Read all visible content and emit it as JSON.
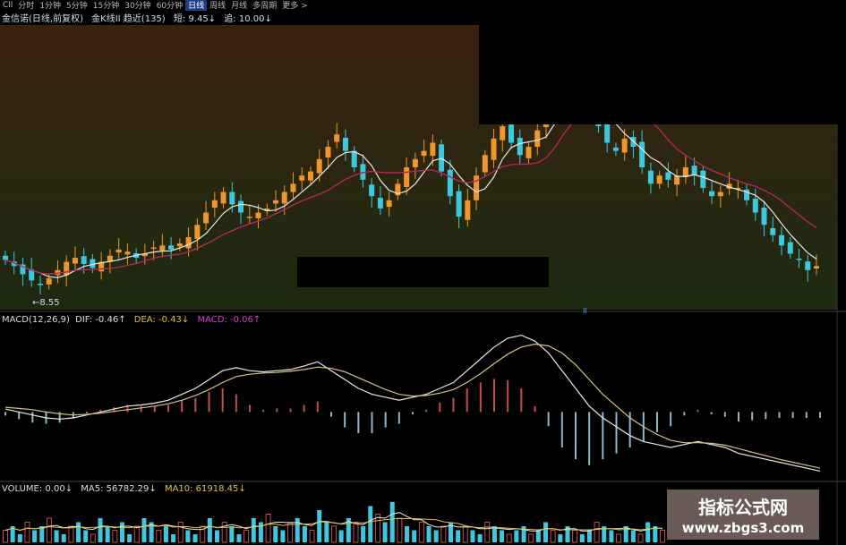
{
  "toolbar": {
    "items": [
      "Cll",
      "分时",
      "1分钟",
      "5分钟",
      "15分钟",
      "30分钟",
      "60分钟",
      "日线",
      "周线",
      "月线",
      "多周期",
      "更多 >"
    ],
    "active_index": 7
  },
  "price_panel": {
    "stock_label": "金信诺(日线,前复权)",
    "indicator_label": "金K线II 趋近(135)",
    "short_label": "短: 9.45↓",
    "up_label": "追: 10.00↓",
    "low_price_label": "8.55",
    "marker_label": "II"
  },
  "macd_panel": {
    "title": "MACD(12,26,9)",
    "dif_label": "DIF: -0.46↑",
    "dea_label": "DEA: -0.43↓",
    "macd_label": "MACD: -0.06↑"
  },
  "volume_panel": {
    "title": "VOLUME: 0.00↓",
    "ma5_label": "MA5: 56782.29↓",
    "ma10_label": "MA10: 61918.45↓"
  },
  "watermark": {
    "line1": "指标公式网",
    "line2": "www.zbgs3.com"
  },
  "colors": {
    "up": "#f0962a",
    "down": "#3ec8e0",
    "ma_short": "#e8e8e8",
    "ma_long": "#b0285a",
    "macd_up": "#c84a4a",
    "macd_down": "#8fb8c8",
    "dif": "#e8e8e8",
    "dea": "#d8c080",
    "ma10_color": "#e0c040",
    "macd_color": "#d040d0"
  },
  "chart_data": {
    "type": "candlestick",
    "close": [
      9.35,
      9.2,
      9.0,
      8.85,
      8.75,
      8.9,
      9.1,
      9.3,
      9.4,
      9.25,
      9.15,
      9.3,
      9.45,
      9.6,
      9.55,
      9.4,
      9.5,
      9.65,
      9.7,
      9.6,
      9.75,
      9.9,
      10.2,
      10.5,
      10.8,
      11.0,
      10.7,
      10.5,
      10.4,
      10.5,
      10.6,
      10.8,
      11.0,
      11.2,
      11.4,
      11.5,
      11.8,
      12.1,
      12.4,
      12.0,
      11.6,
      11.3,
      10.9,
      10.6,
      10.8,
      11.2,
      11.6,
      11.8,
      12.0,
      12.2,
      11.5,
      10.9,
      10.4,
      10.8,
      11.4,
      11.9,
      12.3,
      12.6,
      12.2,
      11.9,
      12.1,
      12.5,
      13.0,
      13.8,
      14.4,
      14.0,
      13.5,
      13.0,
      12.6,
      12.2,
      12.0,
      12.3,
      12.1,
      11.6,
      11.2,
      11.4,
      11.3,
      11.4,
      11.6,
      11.4,
      11.1,
      10.9,
      11.0,
      11.2,
      11.1,
      10.8,
      10.5,
      10.2,
      9.95,
      9.7,
      9.5,
      9.35,
      9.1,
      9.2
    ],
    "dif": [
      0.05,
      0.0,
      -0.05,
      -0.1,
      -0.12,
      -0.1,
      -0.05,
      0.0,
      0.05,
      0.1,
      0.12,
      0.15,
      0.2,
      0.3,
      0.4,
      0.55,
      0.7,
      0.75,
      0.7,
      0.68,
      0.7,
      0.72,
      0.78,
      0.85,
      0.7,
      0.55,
      0.4,
      0.3,
      0.25,
      0.2,
      0.25,
      0.3,
      0.4,
      0.5,
      0.7,
      0.9,
      1.1,
      1.25,
      1.3,
      1.2,
      1.0,
      0.7,
      0.4,
      0.1,
      -0.1,
      -0.25,
      -0.4,
      -0.5,
      -0.55,
      -0.6,
      -0.55,
      -0.5,
      -0.55,
      -0.6,
      -0.7,
      -0.75,
      -0.8,
      -0.85,
      -0.9,
      -0.95,
      -1.0
    ],
    "dea": [
      0.08,
      0.06,
      0.04,
      0.0,
      -0.03,
      -0.05,
      -0.04,
      -0.02,
      0.01,
      0.04,
      0.07,
      0.1,
      0.14,
      0.2,
      0.28,
      0.38,
      0.5,
      0.6,
      0.64,
      0.66,
      0.67,
      0.69,
      0.72,
      0.76,
      0.74,
      0.68,
      0.58,
      0.48,
      0.38,
      0.3,
      0.27,
      0.28,
      0.32,
      0.38,
      0.5,
      0.65,
      0.82,
      0.98,
      1.1,
      1.15,
      1.12,
      1.0,
      0.8,
      0.55,
      0.3,
      0.1,
      -0.1,
      -0.25,
      -0.38,
      -0.48,
      -0.52,
      -0.52,
      -0.53,
      -0.56,
      -0.62,
      -0.68,
      -0.74,
      -0.8,
      -0.85,
      -0.9,
      -0.95
    ],
    "volume": [
      3,
      4,
      2,
      5,
      3,
      4,
      6,
      3,
      2,
      4,
      5,
      3,
      2,
      6,
      4,
      3,
      5,
      2,
      4,
      6,
      5,
      3,
      4,
      2,
      5,
      3,
      2,
      4,
      6,
      3,
      5,
      4,
      2,
      3,
      6,
      5,
      7,
      4,
      3,
      5,
      6,
      4,
      3,
      8,
      5,
      4,
      3,
      6,
      5,
      4,
      9,
      7,
      5,
      10,
      6,
      4,
      3,
      5,
      4,
      3,
      4,
      5,
      3,
      4,
      3,
      2,
      5,
      4,
      3,
      2,
      3,
      4,
      2,
      3,
      5,
      3,
      2,
      4,
      3,
      2,
      3,
      5,
      4,
      3,
      2,
      4,
      3,
      2,
      5,
      4,
      3
    ],
    "ma5_label": "MA5",
    "ma10_label": "MA10"
  }
}
